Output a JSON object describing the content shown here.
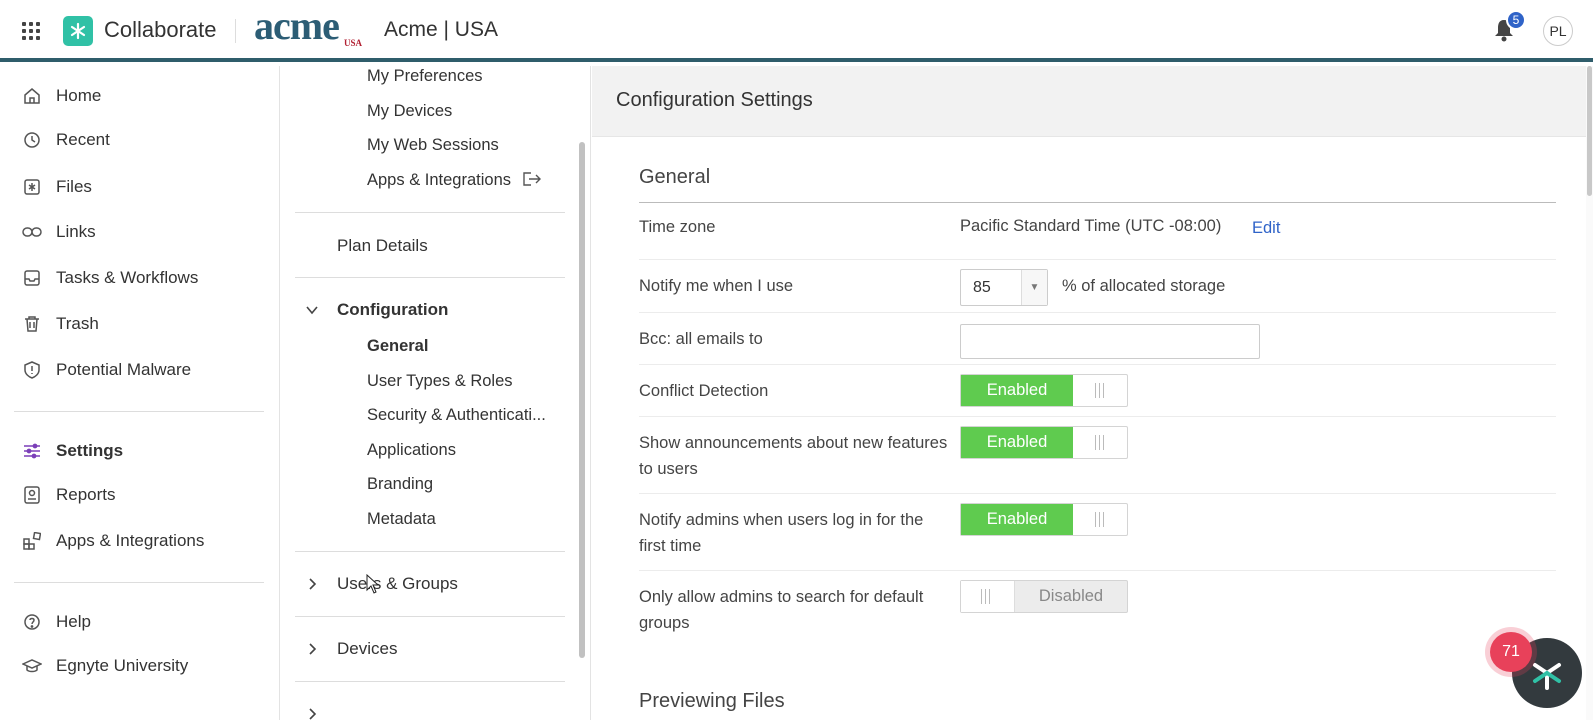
{
  "header": {
    "brand_name": "Collaborate",
    "logo_text": "acme",
    "logo_sub": "USA",
    "org_name": "Acme | USA",
    "notifications_count": "5",
    "avatar_initials": "PL"
  },
  "leftnav": {
    "items": [
      {
        "label": "Home",
        "icon": "home-icon"
      },
      {
        "label": "Recent",
        "icon": "clock-icon"
      },
      {
        "label": "Files",
        "icon": "files-icon"
      },
      {
        "label": "Links",
        "icon": "link-icon"
      },
      {
        "label": "Tasks & Workflows",
        "icon": "inbox-icon"
      },
      {
        "label": "Trash",
        "icon": "trash-icon"
      },
      {
        "label": "Potential Malware",
        "icon": "shield-icon"
      },
      {
        "label": "Settings",
        "icon": "sliders-icon",
        "active": true
      },
      {
        "label": "Reports",
        "icon": "report-icon"
      },
      {
        "label": "Apps & Integrations",
        "icon": "apps-icon"
      },
      {
        "label": "Help",
        "icon": "help-icon"
      },
      {
        "label": "Egnyte University",
        "icon": "graduation-cap-icon"
      }
    ]
  },
  "midnav": {
    "account_items": [
      "My Preferences",
      "My Devices",
      "My Web Sessions",
      "Apps & Integrations"
    ],
    "plan_details": "Plan Details",
    "configuration": {
      "label": "Configuration",
      "items": [
        "General",
        "User Types & Roles",
        "Security & Authenticati...",
        "Applications",
        "Branding",
        "Metadata"
      ]
    },
    "users_groups": "Users & Groups",
    "devices": "Devices"
  },
  "main": {
    "title": "Configuration Settings",
    "general": {
      "title": "General",
      "time_zone": {
        "label": "Time zone",
        "value": "Pacific Standard Time (UTC -08:00)",
        "action": "Edit"
      },
      "notify_storage": {
        "label": "Notify me when I use",
        "value": "85",
        "suffix": "% of allocated storage"
      },
      "bcc": {
        "label": "Bcc: all emails to",
        "value": ""
      },
      "conflict_detection": {
        "label": "Conflict Detection",
        "state": "Enabled"
      },
      "announcements": {
        "label": "Show announcements about new features to users",
        "state": "Enabled"
      },
      "notify_admins": {
        "label": "Notify admins when users log in for the first time",
        "state": "Enabled"
      },
      "admin_search": {
        "label": "Only allow admins to search for default groups",
        "state": "Disabled"
      }
    },
    "previewing_title": "Previewing Files"
  },
  "widget": {
    "badge_count": "71"
  },
  "colors": {
    "accent": "#2f63c8",
    "enabled": "#5fcb4f",
    "header_border": "#2f5d6b",
    "brand_teal": "#30c1a6"
  }
}
